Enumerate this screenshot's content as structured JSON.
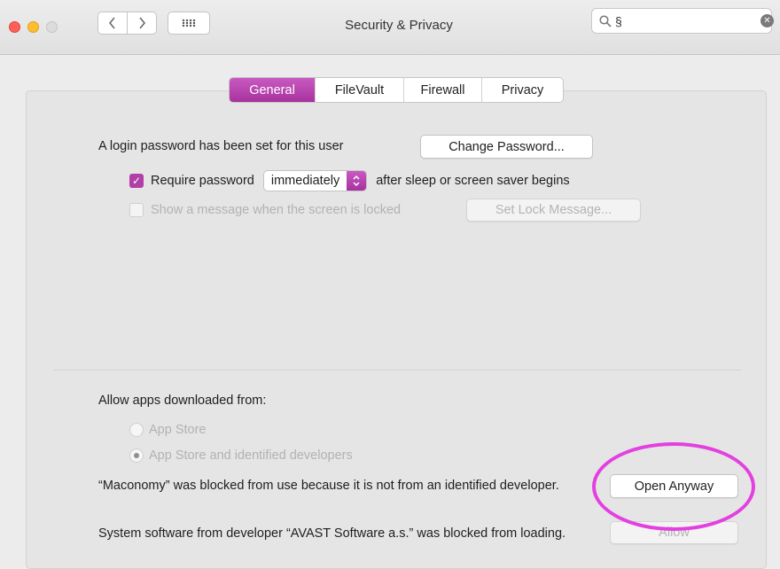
{
  "window": {
    "title": "Security & Privacy",
    "search_value": "§"
  },
  "tabs": [
    {
      "label": "General",
      "active": true
    },
    {
      "label": "FileVault",
      "active": false
    },
    {
      "label": "Firewall",
      "active": false
    },
    {
      "label": "Privacy",
      "active": false
    }
  ],
  "general": {
    "login_text": "A login password has been set for this user",
    "change_password_label": "Change Password...",
    "require_password_label": "Require password",
    "require_password_checked": true,
    "require_delay_value": "immediately",
    "require_after_text": "after sleep or screen saver begins",
    "show_message_label": "Show a message when the screen is locked",
    "show_message_checked": false,
    "set_lock_message_label": "Set Lock Message..."
  },
  "allow_apps": {
    "heading": "Allow apps downloaded from:",
    "options": [
      {
        "label": "App Store",
        "selected": false
      },
      {
        "label": "App Store and identified developers",
        "selected": true
      }
    ]
  },
  "blocked": {
    "maconomy_text": "“Maconomy” was blocked from use because it is not from an identified developer.",
    "open_anyway_label": "Open Anyway",
    "system_software_text": "System software from developer “AVAST Software a.s.” was blocked from loading.",
    "allow_label": "Allow"
  },
  "colors": {
    "accent": "#b13fa8",
    "highlight_ring": "#e340e0"
  }
}
